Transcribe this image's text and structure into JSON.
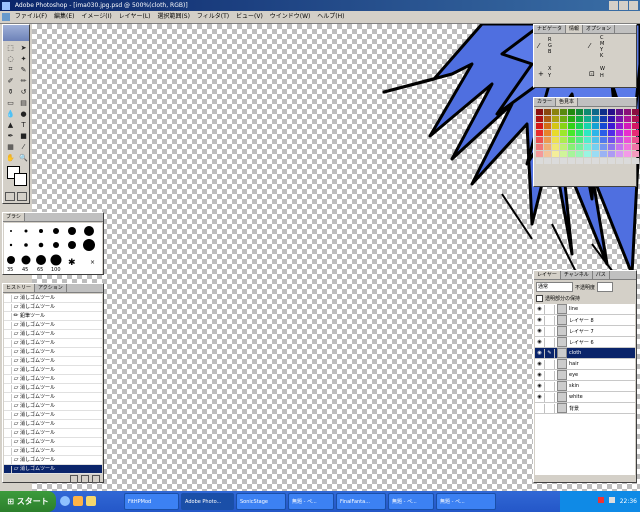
{
  "window": {
    "title": "Adobe Photoshop - [ima030.jpg.psd @ 500%(cloth, RGB)]"
  },
  "menu": [
    "ファイル(F)",
    "編集(E)",
    "イメージ(I)",
    "レイヤー(L)",
    "選択範囲(S)",
    "フィルタ(T)",
    "ビュー(V)",
    "ウインドウ(W)",
    "ヘルプ(H)"
  ],
  "navigator": {
    "tabs": [
      "ナビゲータ",
      "情報",
      "オプション"
    ],
    "labels": [
      "R",
      "G",
      "B",
      "C",
      "M",
      "Y",
      "K",
      "X",
      "Y",
      "W",
      "H"
    ]
  },
  "color_panel": {
    "tabs": [
      "カラー",
      "色見本"
    ]
  },
  "brushes": {
    "tabs": [
      "ブラシ"
    ],
    "sizes": [
      "35",
      "45",
      "65",
      "100"
    ]
  },
  "history": {
    "tabs": [
      "ヒストリー",
      "アクション"
    ],
    "items": [
      "消しゴムツール",
      "消しゴムツール",
      "鉛筆ツール",
      "消しゴムツール",
      "消しゴムツール",
      "消しゴムツール",
      "消しゴムツール",
      "消しゴムツール",
      "消しゴムツール",
      "消しゴムツール",
      "消しゴムツール",
      "消しゴムツール",
      "消しゴムツール",
      "消しゴムツール",
      "消しゴムツール",
      "消しゴムツール",
      "消しゴムツール",
      "消しゴムツール",
      "消しゴムツール",
      "消しゴムツール"
    ],
    "selected_index": 19
  },
  "layers": {
    "tabs": [
      "レイヤー",
      "チャンネル",
      "パス"
    ],
    "blend_mode": "通常",
    "opacity_label": "不透明度",
    "preserve_label": "透明部分の保持",
    "items": [
      "line",
      "レイヤー 8",
      "レイヤー 7",
      "レイヤー 6",
      "cloth",
      "hair",
      "eye",
      "skin",
      "white",
      "背景"
    ],
    "selected_index": 4
  },
  "taskbar": {
    "start": "スタート",
    "buttons": [
      "FitHPMod",
      "Adobe Photo...",
      "SonicStage",
      "無題 - ペ...",
      "FinalFanta...",
      "無題 - ペ...",
      "無題 - ペ..."
    ],
    "active_index": 1,
    "clock": "22:36"
  },
  "colors": {
    "hair": "#4f6fe0",
    "selection": "#0a246a"
  }
}
